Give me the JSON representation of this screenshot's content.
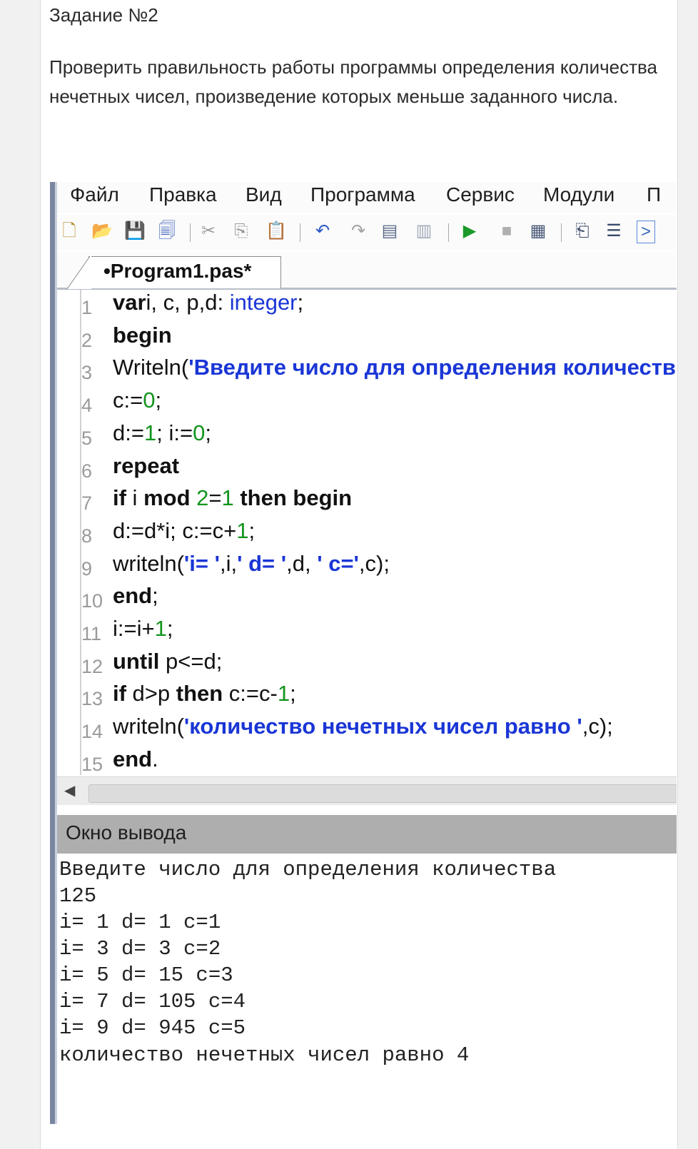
{
  "task": {
    "title": "Задание  №2",
    "text": "Проверить правильность работы программы определения количества нечетных чисел, произведение которых меньше заданного числа."
  },
  "menu": [
    "Файл",
    "Правка",
    "Вид",
    "Программа",
    "Сервис",
    "Модули",
    "П"
  ],
  "toolbar_icons": [
    "new-file-icon",
    "open-folder-icon",
    "save-icon",
    "save-all-icon",
    "cut-icon",
    "copy-icon",
    "paste-icon",
    "undo-icon",
    "redo-icon",
    "find-icon",
    "replace-icon",
    "run-icon",
    "stop-icon",
    "compile-icon",
    "step-into-icon",
    "step-over-icon",
    "console-icon"
  ],
  "tab": {
    "label": "•Program1.pas*"
  },
  "code_lines": [
    {
      "n": "1",
      "parts": [
        [
          "kw",
          "var"
        ],
        [
          "",
          "i, c, p,d: "
        ],
        [
          "ty",
          "integer"
        ],
        [
          "",
          ";"
        ]
      ]
    },
    {
      "n": "2",
      "parts": [
        [
          "kw",
          "begin"
        ]
      ]
    },
    {
      "n": "3",
      "parts": [
        [
          "",
          "Writeln("
        ],
        [
          "str",
          "'Введите число для определения количеств"
        ]
      ]
    },
    {
      "n": "4",
      "parts": [
        [
          "",
          "c:="
        ],
        [
          "num",
          "0"
        ],
        [
          "",
          ";"
        ]
      ]
    },
    {
      "n": "5",
      "parts": [
        [
          "",
          "d:="
        ],
        [
          "num",
          "1"
        ],
        [
          "",
          "; i:="
        ],
        [
          "num",
          "0"
        ],
        [
          "",
          ";"
        ]
      ]
    },
    {
      "n": "6",
      "parts": [
        [
          "kw",
          "repeat"
        ]
      ]
    },
    {
      "n": "7",
      "parts": [
        [
          "kw",
          "if"
        ],
        [
          "",
          " i "
        ],
        [
          "kw",
          "mod"
        ],
        [
          "",
          " "
        ],
        [
          "num",
          "2"
        ],
        [
          "",
          "="
        ],
        [
          "num",
          "1"
        ],
        [
          "",
          " "
        ],
        [
          "kw",
          "then begin"
        ]
      ]
    },
    {
      "n": "8",
      "parts": [
        [
          "",
          "d:=d*i; c:=c+"
        ],
        [
          "num",
          "1"
        ],
        [
          "",
          ";"
        ]
      ]
    },
    {
      "n": "9",
      "parts": [
        [
          "",
          "writeln("
        ],
        [
          "str",
          "'i= '"
        ],
        [
          "",
          ",i,"
        ],
        [
          "str",
          "' d= '"
        ],
        [
          "",
          ",d, "
        ],
        [
          "str",
          "' c='"
        ],
        [
          "",
          ",c);"
        ]
      ]
    },
    {
      "n": "10",
      "parts": [
        [
          "kw",
          "end"
        ],
        [
          "",
          ";"
        ]
      ]
    },
    {
      "n": "11",
      "parts": [
        [
          "",
          "i:=i+"
        ],
        [
          "num",
          "1"
        ],
        [
          "",
          ";"
        ]
      ]
    },
    {
      "n": "12",
      "parts": [
        [
          "kw",
          "until"
        ],
        [
          "",
          " p<=d;"
        ]
      ]
    },
    {
      "n": "13",
      "parts": [
        [
          "kw",
          "if"
        ],
        [
          "",
          " d>p "
        ],
        [
          "kw",
          "then"
        ],
        [
          "",
          " c:=c-"
        ],
        [
          "num",
          "1"
        ],
        [
          "",
          ";"
        ]
      ]
    },
    {
      "n": "14",
      "parts": [
        [
          "",
          "writeln("
        ],
        [
          "str",
          "'количество нечетных чисел равно '"
        ],
        [
          "",
          ",c);"
        ]
      ]
    },
    {
      "n": "15",
      "parts": [
        [
          "kw",
          "end"
        ],
        [
          "",
          "."
        ]
      ]
    }
  ],
  "output": {
    "title": "Окно вывода",
    "lines": [
      "Введите число для определения количества",
      "125",
      "i= 1 d= 1 c=1",
      "i= 3 d= 3 c=2",
      "i= 5 d= 15 c=3",
      "i= 7 d= 105 c=4",
      "i= 9 d= 945 c=5",
      "количество нечетных чисел равно 4"
    ]
  }
}
